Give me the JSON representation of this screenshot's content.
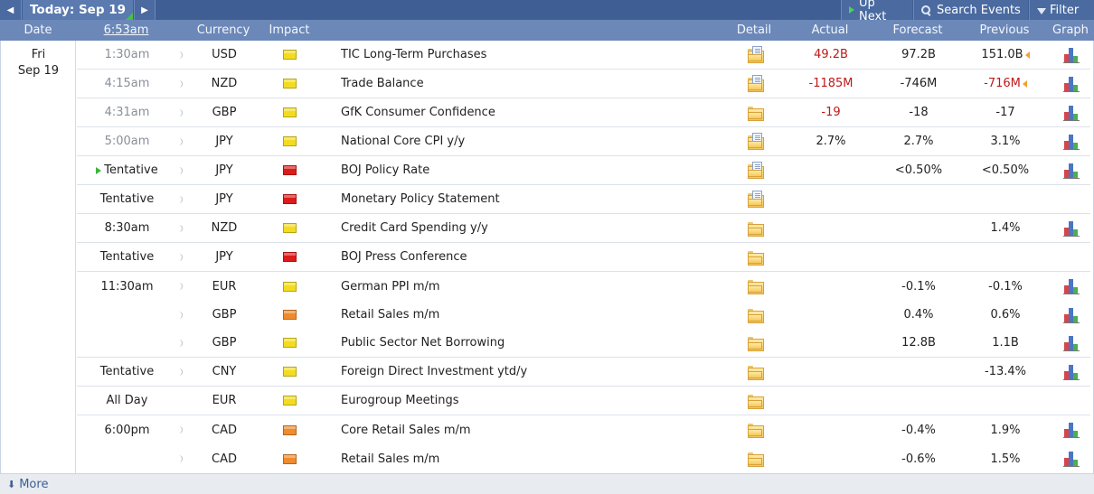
{
  "toolbar": {
    "today_label": "Today: Sep 19",
    "up_next": "Up Next",
    "search_events": "Search Events",
    "filter": "Filter"
  },
  "header": {
    "date": "Date",
    "time": "6:53am",
    "currency": "Currency",
    "impact": "Impact",
    "detail": "Detail",
    "actual": "Actual",
    "forecast": "Forecast",
    "previous": "Previous",
    "graph": "Graph"
  },
  "day": {
    "weekday": "Fri",
    "date": "Sep 19"
  },
  "colors": {
    "low": "#f3dc1f",
    "medium": "#ef8b2c",
    "high": "#dd1b1b"
  },
  "events": [
    {
      "time": "1:30am",
      "time_dim": true,
      "currency": "USD",
      "impact": "low",
      "event": "TIC Long-Term Purchases",
      "detail_icon": "document-folder",
      "actual": "49.2B",
      "actual_red": true,
      "forecast": "97.2B",
      "previous": "151.0B",
      "revised": true,
      "graph": true
    },
    {
      "time": "4:15am",
      "time_dim": true,
      "currency": "NZD",
      "impact": "low",
      "event": "Trade Balance",
      "detail_icon": "document-folder",
      "actual": "-1185M",
      "actual_red": true,
      "forecast": "-746M",
      "previous": "-716M",
      "previous_red": true,
      "revised": true,
      "graph": true
    },
    {
      "time": "4:31am",
      "time_dim": true,
      "currency": "GBP",
      "impact": "low",
      "event": "GfK Consumer Confidence",
      "detail_icon": "folder",
      "actual": "-19",
      "actual_red": true,
      "forecast": "-18",
      "previous": "-17",
      "graph": true
    },
    {
      "time": "5:00am",
      "time_dim": true,
      "currency": "JPY",
      "impact": "low",
      "event": "National Core CPI y/y",
      "detail_icon": "document-folder",
      "actual": "2.7%",
      "forecast": "2.7%",
      "previous": "3.1%",
      "graph": true
    },
    {
      "time": "Tentative",
      "tentative_marker": true,
      "currency": "JPY",
      "impact": "high",
      "event": "BOJ Policy Rate",
      "detail_icon": "document-folder",
      "actual": "",
      "forecast": "<0.50%",
      "previous": "<0.50%",
      "graph": true
    },
    {
      "time": "Tentative",
      "currency": "JPY",
      "impact": "high",
      "event": "Monetary Policy Statement",
      "detail_icon": "document-folder",
      "actual": "",
      "forecast": "",
      "previous": "",
      "graph": false
    },
    {
      "time": "8:30am",
      "currency": "NZD",
      "impact": "low",
      "event": "Credit Card Spending y/y",
      "detail_icon": "folder",
      "actual": "",
      "forecast": "",
      "previous": "1.4%",
      "graph": true
    },
    {
      "time": "Tentative",
      "currency": "JPY",
      "impact": "high",
      "event": "BOJ Press Conference",
      "detail_icon": "folder",
      "actual": "",
      "forecast": "",
      "previous": "",
      "graph": false
    },
    {
      "time": "11:30am",
      "currency": "EUR",
      "impact": "low",
      "event": "German PPI m/m",
      "detail_icon": "folder",
      "actual": "",
      "forecast": "-0.1%",
      "previous": "-0.1%",
      "graph": true
    },
    {
      "time": "",
      "currency": "GBP",
      "impact": "medium",
      "event": "Retail Sales m/m",
      "detail_icon": "folder",
      "actual": "",
      "forecast": "0.4%",
      "previous": "0.6%",
      "graph": true
    },
    {
      "time": "",
      "currency": "GBP",
      "impact": "low",
      "event": "Public Sector Net Borrowing",
      "detail_icon": "folder",
      "actual": "",
      "forecast": "12.8B",
      "previous": "1.1B",
      "graph": true
    },
    {
      "time": "Tentative",
      "currency": "CNY",
      "impact": "low",
      "event": "Foreign Direct Investment ytd/y",
      "detail_icon": "folder",
      "actual": "",
      "forecast": "",
      "previous": "-13.4%",
      "graph": true
    },
    {
      "time": "All Day",
      "currency": "EUR",
      "impact": "low",
      "event": "Eurogroup Meetings",
      "detail_icon": "folder",
      "actual": "",
      "forecast": "",
      "previous": "",
      "graph": false
    },
    {
      "time": "6:00pm",
      "currency": "CAD",
      "impact": "medium",
      "event": "Core Retail Sales m/m",
      "detail_icon": "folder",
      "actual": "",
      "forecast": "-0.4%",
      "previous": "1.9%",
      "graph": true
    },
    {
      "time": "",
      "currency": "CAD",
      "impact": "medium",
      "event": "Retail Sales m/m",
      "detail_icon": "folder",
      "actual": "",
      "forecast": "-0.6%",
      "previous": "1.5%",
      "graph": true
    }
  ],
  "footer": {
    "more": "More"
  }
}
